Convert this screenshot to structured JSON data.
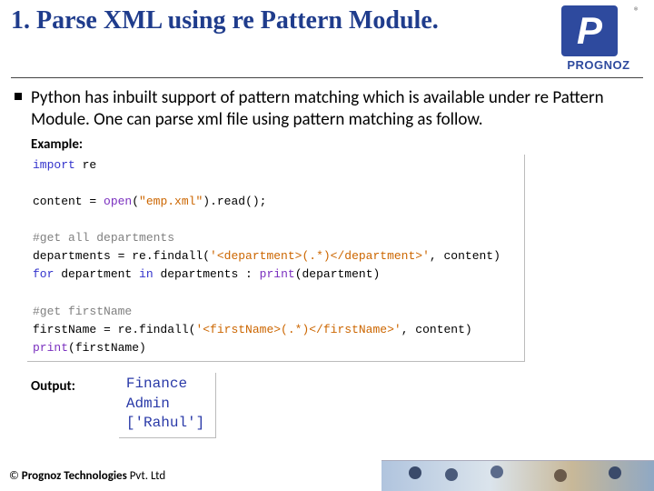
{
  "header": {
    "title": "1. Parse XML using re Pattern Module.",
    "logo_text": "PROGNOZ",
    "reg": "®"
  },
  "body": {
    "paragraph": "Python has inbuilt support of pattern matching which is available under re Pattern Module. One can parse xml file using pattern matching as follow.",
    "example_label": "Example:",
    "output_label": "Output:"
  },
  "code": {
    "l1a": "import",
    "l1b": " re",
    "l2a": "content = ",
    "l2b": "open",
    "l2c": "(",
    "l2d": "\"emp.xml\"",
    "l2e": ").read();",
    "l3": "#get all departments",
    "l4a": "departments = re.findall(",
    "l4b": "'<department>(.*)</department>'",
    "l4c": ", content)",
    "l5a": "for",
    "l5b": " department ",
    "l5c": "in",
    "l5d": " departments : ",
    "l5e": "print",
    "l5f": "(department)",
    "l6": "#get firstName",
    "l7a": "firstName = re.findall(",
    "l7b": "'<firstName>(.*)</firstName>'",
    "l7c": ", content)",
    "l8a": "print",
    "l8b": "(firstName)"
  },
  "output": {
    "line1": "Finance",
    "line2": "Admin",
    "line3": "['Rahul']"
  },
  "footer": {
    "copyright_prefix": "© ",
    "copyright_bold": "Prognoz Technologies ",
    "copyright_rest": "Pvt. Ltd"
  }
}
